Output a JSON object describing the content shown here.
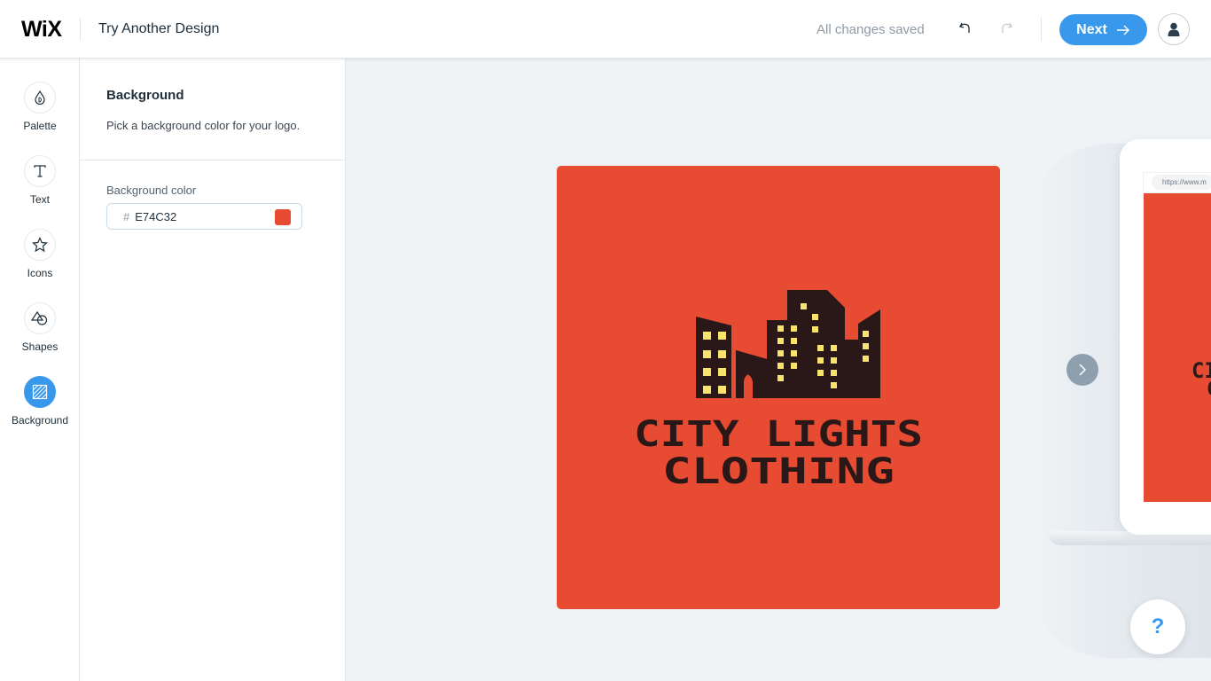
{
  "header": {
    "brand": "WiX",
    "title": "Try Another Design",
    "save_status": "All changes saved",
    "undo_icon": "undo-icon",
    "redo_icon": "redo-icon",
    "next_label": "Next",
    "next_icon": "arrow-right-icon",
    "avatar_icon": "user-icon"
  },
  "rail": {
    "items": [
      {
        "label": "Palette",
        "icon": "droplet-icon",
        "active": false
      },
      {
        "label": "Text",
        "icon": "text-icon",
        "active": false
      },
      {
        "label": "Icons",
        "icon": "star-icon",
        "active": false
      },
      {
        "label": "Shapes",
        "icon": "shapes-icon",
        "active": false
      },
      {
        "label": "Background",
        "icon": "background-icon",
        "active": true
      }
    ]
  },
  "panel": {
    "title": "Background",
    "description": "Pick a background color for your logo.",
    "field_label": "Background color",
    "hash": "#",
    "color_value": "E74C32"
  },
  "colors": {
    "accent": "#3899ec",
    "logo_background": "#E74C32",
    "building": "#2a1718",
    "window": "#f8e46c"
  },
  "logo": {
    "line1": "CITY LIGHTS",
    "line2": "CLOTHING"
  },
  "preview": {
    "url": "https://www.m",
    "text1": "CI",
    "text2": "C"
  },
  "help": {
    "label": "?"
  }
}
